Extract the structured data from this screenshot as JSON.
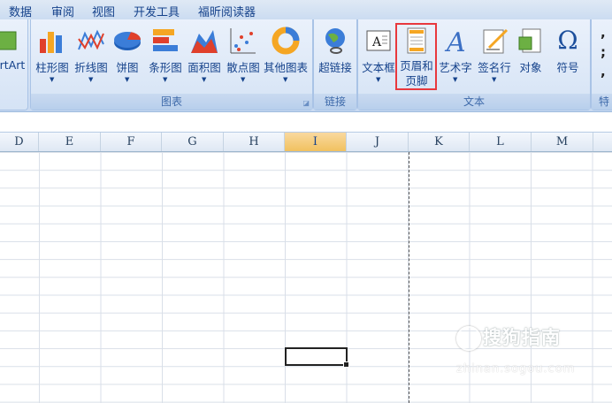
{
  "menu": [
    "数据",
    "审阅",
    "视图",
    "开发工具",
    "福昕阅读器"
  ],
  "ribbon": {
    "left_cutoff_label": "rtArt",
    "charts_group": {
      "label": "图表",
      "buttons": [
        "柱形图",
        "折线图",
        "饼图",
        "条形图",
        "面积图",
        "散点图",
        "其他图表"
      ]
    },
    "links_group": {
      "label": "链接",
      "button": "超链接"
    },
    "text_group": {
      "label": "文本",
      "buttons": [
        "文本框",
        "页眉和页脚",
        "艺术字",
        "签名行",
        "对象",
        "符号"
      ],
      "header_footer_line1": "页眉和",
      "header_footer_line2": "页脚",
      "omega_glyph": "Ω"
    },
    "right_cutoff_label": "特",
    "right_punct": ", ; ,"
  },
  "columns": [
    "D",
    "E",
    "F",
    "G",
    "H",
    "I",
    "J",
    "K",
    "L",
    "M"
  ],
  "selected_column": "I",
  "watermark": {
    "text": "搜狗指南",
    "sub": "zhinan.sogou.com"
  },
  "colors": {
    "accent": "#15428b",
    "highlight": "#e8383d",
    "selected_header": "#f1c15f"
  }
}
